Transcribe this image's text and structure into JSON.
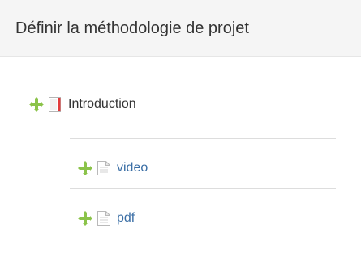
{
  "header": {
    "title": "Définir la méthodologie de projet"
  },
  "tree": {
    "section": {
      "label": "Introduction",
      "icon": "chapter-icon",
      "handle_icon": "move-handle-icon"
    },
    "items": [
      {
        "label": "video",
        "icon": "document-icon",
        "handle_icon": "move-handle-icon"
      },
      {
        "label": "pdf",
        "icon": "document-icon",
        "handle_icon": "move-handle-icon"
      }
    ]
  },
  "colors": {
    "accent_green": "#8bc34a",
    "link_blue": "#3a6ea5",
    "chapter_red": "#e23b3b"
  }
}
